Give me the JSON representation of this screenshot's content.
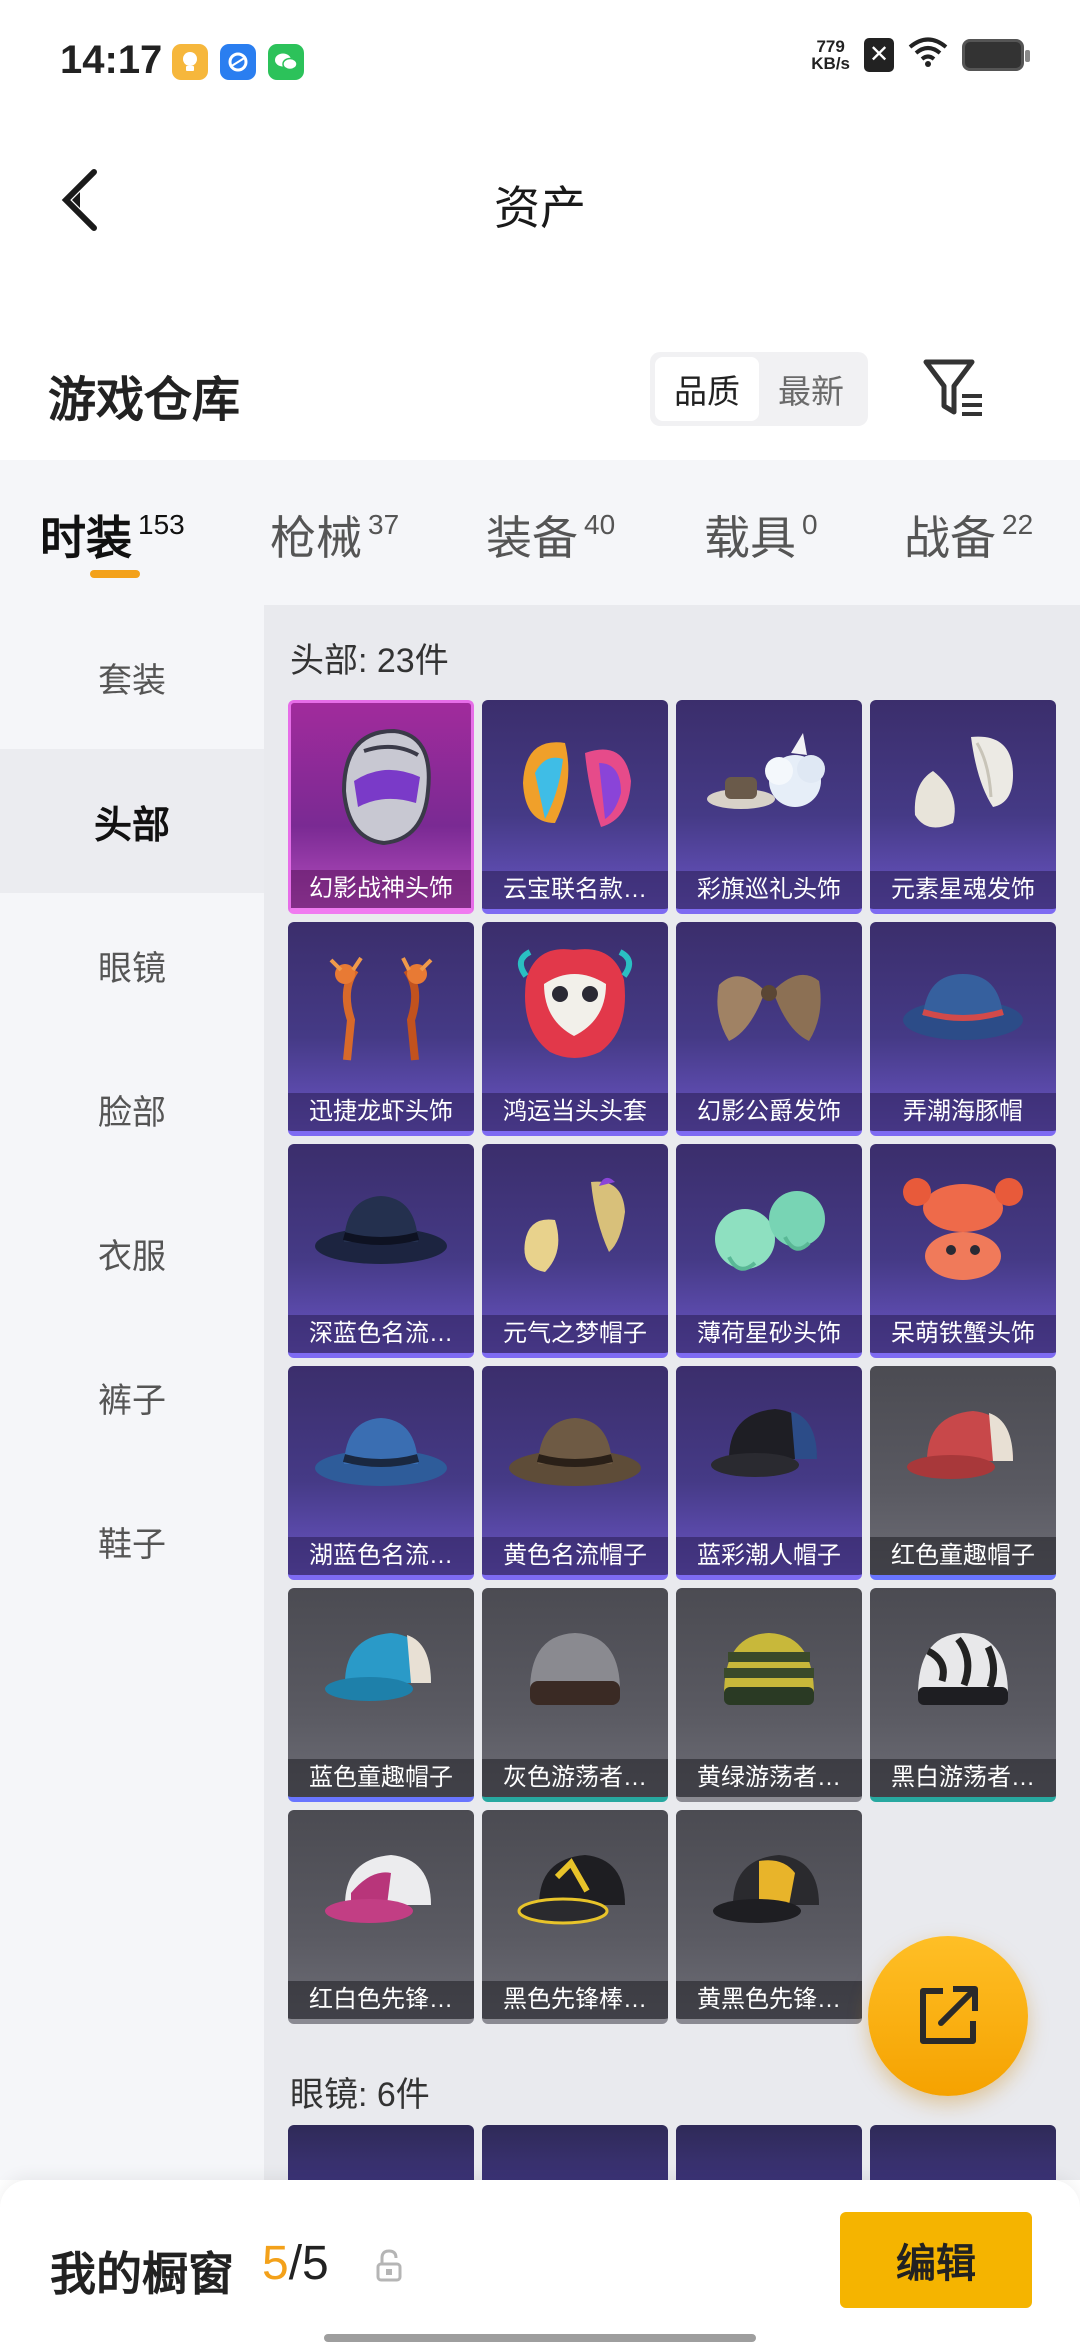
{
  "status_bar": {
    "time": "14:17",
    "net_speed_value": "779",
    "net_speed_unit": "KB/s",
    "apps": [
      "lightbulb-app-icon",
      "browser-app-icon",
      "wechat-app-icon"
    ],
    "icons": [
      "x-box-icon",
      "wifi-icon",
      "battery-icon"
    ]
  },
  "nav": {
    "title": "资产",
    "back_icon": "chevron-left-icon"
  },
  "header": {
    "title": "游戏仓库",
    "sort_options": [
      "品质",
      "最新"
    ],
    "sort_selected": "品质",
    "filter_icon": "filter-icon"
  },
  "tabs": [
    {
      "label": "时装",
      "count": "153",
      "active": true
    },
    {
      "label": "枪械",
      "count": "37",
      "active": false
    },
    {
      "label": "装备",
      "count": "40",
      "active": false
    },
    {
      "label": "载具",
      "count": "0",
      "active": false
    },
    {
      "label": "战备",
      "count": "22",
      "active": false
    }
  ],
  "sidebar": {
    "items": [
      {
        "label": "套装",
        "active": false
      },
      {
        "label": "头部",
        "active": true
      },
      {
        "label": "眼镜",
        "active": false
      },
      {
        "label": "脸部",
        "active": false
      },
      {
        "label": "衣服",
        "active": false
      },
      {
        "label": "裤子",
        "active": false
      },
      {
        "label": "鞋子",
        "active": false
      }
    ]
  },
  "sections": {
    "head_title": "头部: 23件",
    "glasses_title": "眼镜: 6件"
  },
  "items": [
    {
      "label": "幻影战神头饰",
      "rarity": "pink",
      "icon": "helmet-icon"
    },
    {
      "label": "云宝联名款…",
      "rarity": "purple",
      "icon": "rainbow-hair-icon"
    },
    {
      "label": "彩旗巡礼头饰",
      "rarity": "purple",
      "icon": "hat-with-sheep-icon"
    },
    {
      "label": "元素星魂发饰",
      "rarity": "purple",
      "icon": "white-hair-icon"
    },
    {
      "label": "迅捷龙虾头饰",
      "rarity": "purple",
      "icon": "lobster-headband-icon"
    },
    {
      "label": "鸿运当头头套",
      "rarity": "purple",
      "icon": "lion-mask-icon"
    },
    {
      "label": "幻影公爵发饰",
      "rarity": "purple",
      "icon": "brown-hair-icon"
    },
    {
      "label": "弄潮海豚帽",
      "rarity": "purple",
      "icon": "bucket-hat-icon"
    },
    {
      "label": "深蓝色名流…",
      "rarity": "purple",
      "icon": "navy-fedora-icon"
    },
    {
      "label": "元气之梦帽子",
      "rarity": "purple",
      "icon": "blonde-hair-icon"
    },
    {
      "label": "薄荷星砂头饰",
      "rarity": "purple",
      "icon": "mint-hair-icon"
    },
    {
      "label": "呆萌铁蟹头饰",
      "rarity": "purple",
      "icon": "crab-hat-icon"
    },
    {
      "label": "湖蓝色名流…",
      "rarity": "purple",
      "icon": "blue-fedora-icon"
    },
    {
      "label": "黄色名流帽子",
      "rarity": "purple",
      "icon": "brown-fedora-icon"
    },
    {
      "label": "蓝彩潮人帽子",
      "rarity": "purple",
      "icon": "trucker-cap-icon"
    },
    {
      "label": "红色童趣帽子",
      "rarity": "grey",
      "icon": "red-cap-icon"
    },
    {
      "label": "蓝色童趣帽子",
      "rarity": "grey",
      "icon": "blue-cap-icon"
    },
    {
      "label": "灰色游荡者…",
      "rarity": "grey-teal",
      "icon": "grey-beanie-icon"
    },
    {
      "label": "黄绿游荡者…",
      "rarity": "grey-plain",
      "icon": "striped-beanie-icon"
    },
    {
      "label": "黑白游荡者…",
      "rarity": "grey-teal",
      "icon": "zebra-beanie-icon"
    },
    {
      "label": "红白色先锋…",
      "rarity": "grey-plain",
      "icon": "pink-cap-icon"
    },
    {
      "label": "黑色先锋棒…",
      "rarity": "grey-plain",
      "icon": "black-cap-icon"
    },
    {
      "label": "黄黑色先锋…",
      "rarity": "grey-plain",
      "icon": "yellow-black-cap-icon"
    }
  ],
  "fab_icon": "share-out-icon",
  "bottom_bar": {
    "title": "我的橱窗",
    "count_current": "5",
    "count_sep": "/",
    "count_total": "5",
    "lock_icon": "lock-icon",
    "edit_label": "编辑"
  },
  "colors": {
    "accent": "#f3a11a",
    "edit_button": "#f5b400",
    "purple_card": "#453a86",
    "pink_card": "#a12b9c",
    "grey_card": "#5a5a62"
  }
}
